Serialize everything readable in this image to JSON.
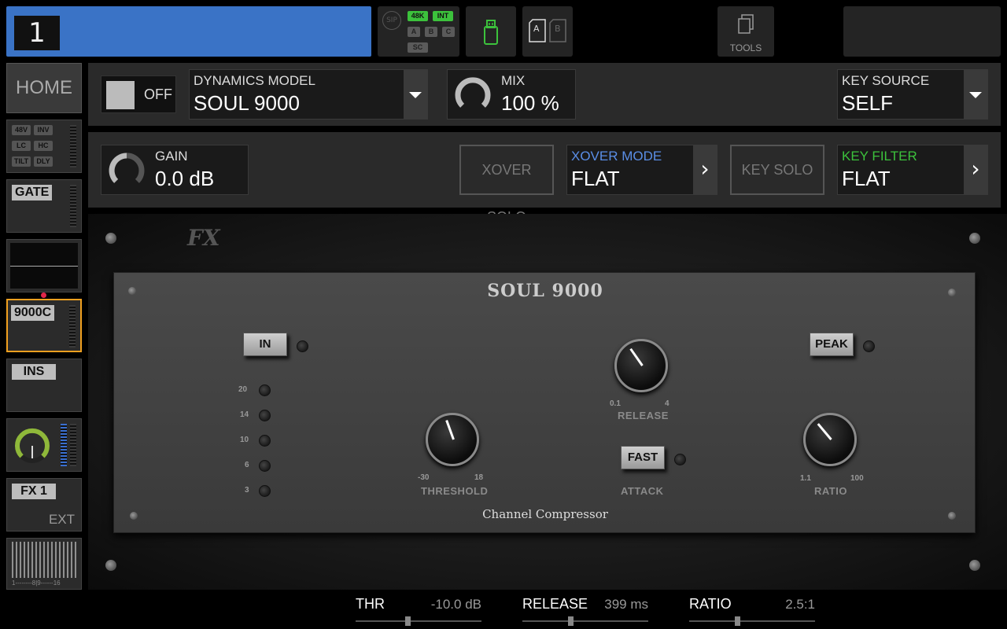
{
  "channel": {
    "number": "1"
  },
  "status": {
    "sip": "SIP",
    "rate": "48K",
    "clock": "INT",
    "a": "A",
    "b": "B",
    "c": "C",
    "sc": "SC"
  },
  "cards": {
    "a": "A",
    "b": "B"
  },
  "tools_label": "TOOLS",
  "sidebar": {
    "home": "HOME",
    "input": {
      "p48v": "48V",
      "inv": "INV",
      "lc": "LC",
      "hc": "HC",
      "tilt": "TILT",
      "dly": "DLY"
    },
    "gate": "GATE",
    "dyn": "9000C",
    "ins": "INS",
    "fx": "FX 1",
    "fx_ext": "EXT",
    "sends_scale": "1--------8|9------16"
  },
  "header1": {
    "toggle_label": "OFF",
    "model_label": "DYNAMICS MODEL",
    "model_value": "SOUL 9000",
    "mix_label": "MIX",
    "mix_value": "100 %",
    "key_source_label": "KEY SOURCE",
    "key_source_value": "SELF"
  },
  "header2": {
    "gain_label": "GAIN",
    "gain_value": "0.0 dB",
    "xover_solo": "XOVER SOLO",
    "xover_mode_label": "XOVER MODE",
    "xover_mode_value": "FLAT",
    "key_solo": "KEY SOLO",
    "key_filter_label": "KEY FILTER",
    "key_filter_value": "FLAT"
  },
  "plugin": {
    "brand": "FX",
    "title": "SOUL 9000",
    "subtitle": "Channel Compressor",
    "in_button": "IN",
    "peak_button": "PEAK",
    "fast_button": "FAST",
    "meter_labels": [
      "20",
      "14",
      "10",
      "6",
      "3"
    ],
    "threshold": {
      "label": "THRESHOLD",
      "min": "-30",
      "max": "18"
    },
    "release": {
      "label": "RELEASE",
      "min": "0.1",
      "max": "4"
    },
    "attack": {
      "label": "ATTACK"
    },
    "ratio": {
      "label": "RATIO",
      "min": "1.1",
      "max": "100"
    }
  },
  "bottom": {
    "thr_name": "THR",
    "thr_value": "-10.0 dB",
    "release_name": "RELEASE",
    "release_value": "399 ms",
    "ratio_name": "RATIO",
    "ratio_value": "2.5:1"
  },
  "colors": {
    "accent_blue": "#3a73c6",
    "key_green": "#3cc23c",
    "xover_blue": "#5a8ee6",
    "selected_orange": "#f0a020"
  }
}
